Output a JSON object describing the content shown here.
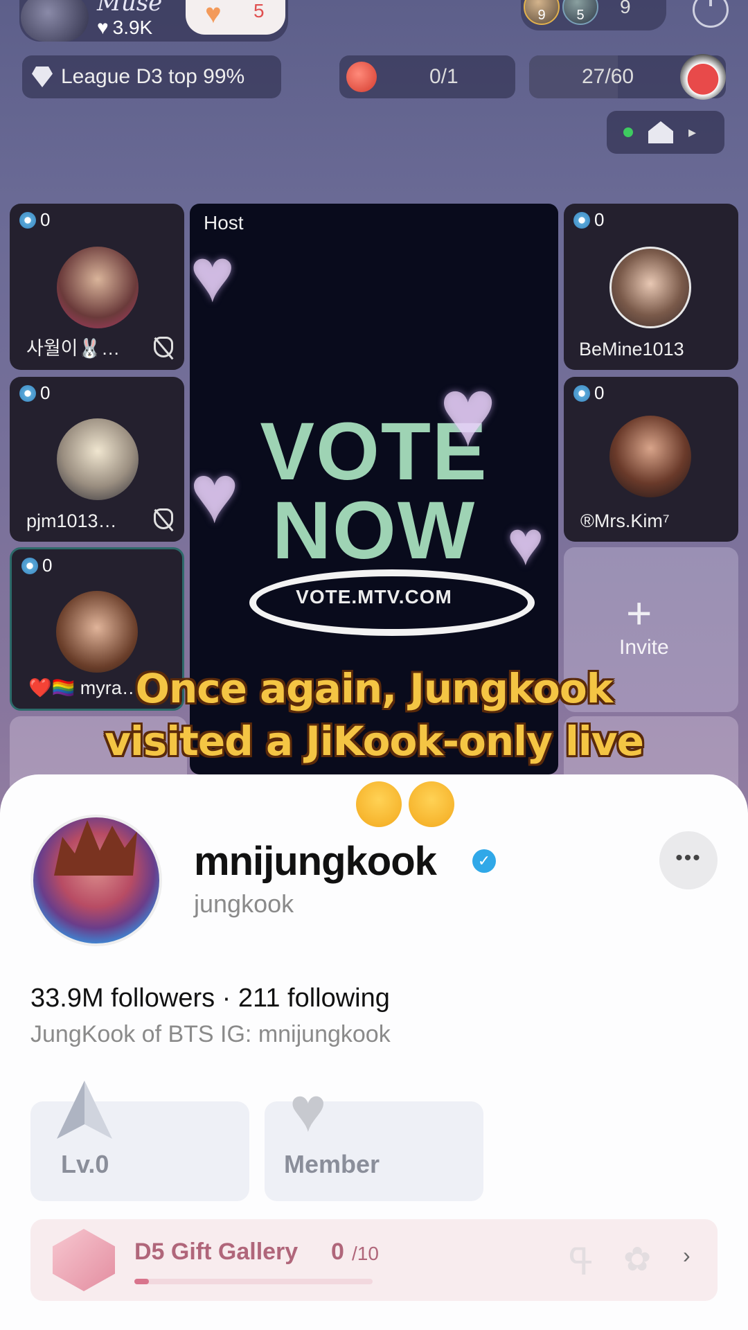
{
  "top_bar": {
    "room_name": "Muse",
    "likes": "3.9K",
    "gift_count": "5",
    "audience_avatar_badges": [
      "9",
      "5"
    ],
    "audience_count": "9"
  },
  "status_row": {
    "league_label": "League D3 top 99%",
    "task_progress": "0/1",
    "level_progress": "27/60",
    "level_fraction": 0.45
  },
  "seats": [
    {
      "score": "0",
      "name": "사월이🐰…",
      "muted": true
    },
    {
      "score": "0",
      "name": "pjm1013…",
      "muted": true
    },
    {
      "score": "0",
      "name": "❤️🏳️‍🌈 myra…",
      "muted": false
    },
    {
      "score": "0",
      "name": "BeMine1013",
      "muted": false
    },
    {
      "score": "0",
      "name": "®Mrs.Kim⁷",
      "muted": false
    }
  ],
  "host": {
    "label": "Host",
    "vote_line1": "VOTE",
    "vote_line2": "NOW",
    "vote_url": "VOTE.MTV.COM"
  },
  "invite": {
    "plus": "+",
    "label": "Invite"
  },
  "caption": {
    "line1": "Once again, Jungkook",
    "line2": "visited a JiKook-only live"
  },
  "profile": {
    "display_name": "mnijungkook",
    "handle": "jungkook",
    "stats": "33.9M followers · 211 following",
    "bio": "JungKook of BTS IG: mnijungkook",
    "more_label": "•••",
    "verified_mark": "✓"
  },
  "cards": {
    "level_label": "Lv.0",
    "member_label": "Member"
  },
  "gallery": {
    "title": "D5 Gift Gallery",
    "count": "0",
    "total": "/10",
    "fraction": 0.06
  },
  "colors": {
    "caption_fill": "#f4c544",
    "caption_stroke": "#5a2a0a",
    "verified_blue": "#30a8e8",
    "vote_green": "#9ed3b4",
    "gallery_pink": "#b0667a"
  }
}
